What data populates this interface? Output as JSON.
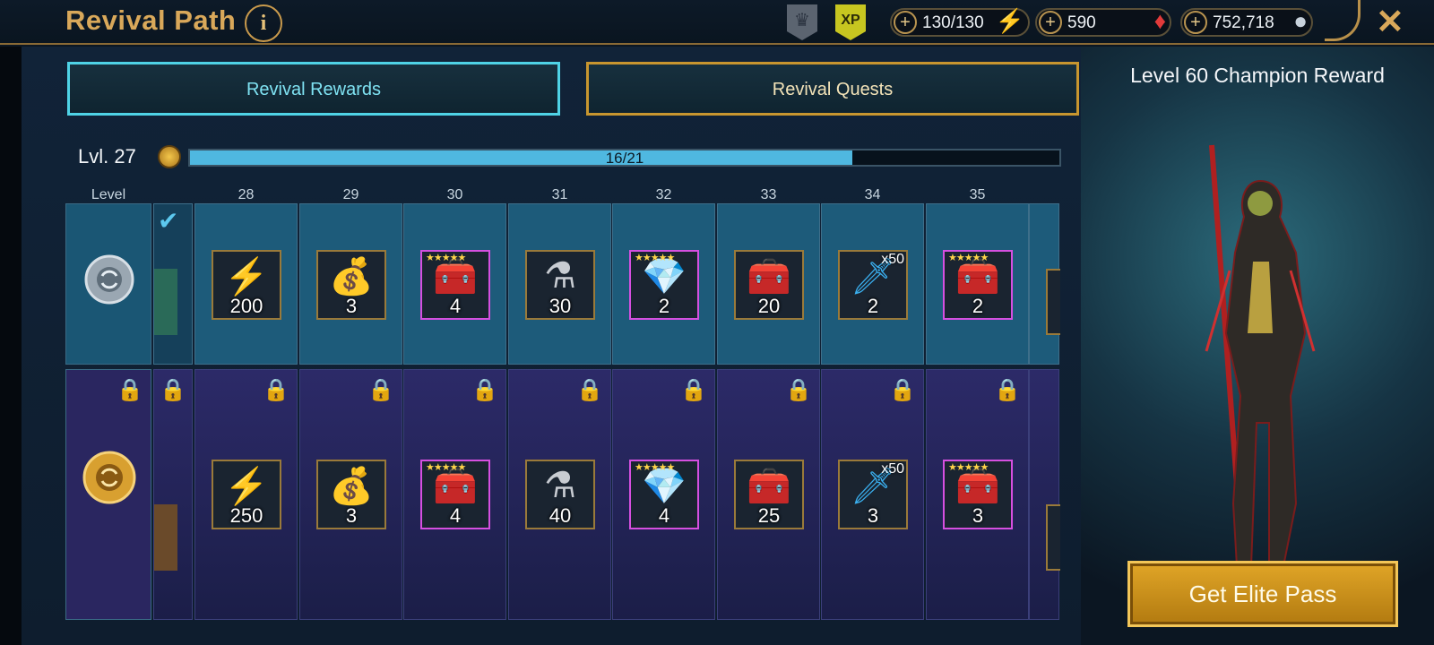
{
  "header": {
    "title": "Revival Path",
    "info_label": "i",
    "xp_badge": "XP",
    "energy": "130/130",
    "gems": "590",
    "silver": "752,718",
    "close_label": "✕"
  },
  "tabs": [
    {
      "label": "Revival Rewards",
      "active": true
    },
    {
      "label": "Revival Quests",
      "active": false
    }
  ],
  "progress": {
    "level_label": "Lvl. 27",
    "text": "16/21",
    "fraction": 0.762
  },
  "grid": {
    "level_header": "Level",
    "levels": [
      "28",
      "29",
      "30",
      "31",
      "32",
      "33",
      "34",
      "35"
    ],
    "free_rewards": [
      {
        "icon": "energy-icon",
        "count": "200"
      },
      {
        "icon": "money-bag-icon",
        "count": "3"
      },
      {
        "icon": "chest-icon",
        "count": "4",
        "stars": "★★★★★"
      },
      {
        "icon": "potion-icon",
        "count": "30"
      },
      {
        "icon": "crystal-icon",
        "count": "2",
        "stars": "★★★★★"
      },
      {
        "icon": "silver-chest-icon",
        "count": "20"
      },
      {
        "icon": "sword-ring-icon",
        "count": "2",
        "mult": "x50"
      },
      {
        "icon": "chest-icon",
        "count": "2",
        "stars": "★★★★★"
      }
    ],
    "elite_rewards": [
      {
        "icon": "energy-icon",
        "count": "250"
      },
      {
        "icon": "money-bag-icon",
        "count": "3"
      },
      {
        "icon": "chest-icon",
        "count": "4",
        "stars": "★★★★★"
      },
      {
        "icon": "potion-icon",
        "count": "40"
      },
      {
        "icon": "crystal-icon",
        "count": "4",
        "stars": "★★★★★"
      },
      {
        "icon": "silver-chest-icon",
        "count": "25"
      },
      {
        "icon": "sword-ring-icon",
        "count": "3",
        "mult": "x50"
      },
      {
        "icon": "chest-icon",
        "count": "3",
        "stars": "★★★★★"
      }
    ]
  },
  "right_panel": {
    "title": "Level 60 Champion Reward",
    "button": "Get Elite Pass"
  },
  "colors": {
    "gold": "#d9a85a",
    "cyan": "#4fd3e6",
    "progress_fill": "#4fb8e0"
  }
}
